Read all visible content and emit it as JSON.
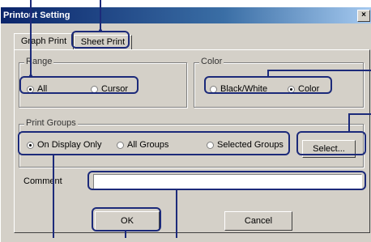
{
  "window": {
    "title": "Printout Setting",
    "close_glyph": "×"
  },
  "tabs": [
    {
      "label": "Graph Print"
    },
    {
      "label": "Sheet Print"
    }
  ],
  "range": {
    "legend": "Range",
    "options": [
      {
        "label": "All",
        "selected": true
      },
      {
        "label": "Cursor",
        "selected": false
      }
    ]
  },
  "color": {
    "legend": "Color",
    "options": [
      {
        "label": "Black/White",
        "selected": false
      },
      {
        "label": "Color",
        "selected": true
      }
    ]
  },
  "print_groups": {
    "legend": "Print Groups",
    "options": [
      {
        "label": "On Display Only",
        "selected": true
      },
      {
        "label": "All Groups",
        "selected": false
      },
      {
        "label": "Selected Groups",
        "selected": false
      }
    ],
    "select_label": "Select..."
  },
  "comment": {
    "label": "Comment",
    "value": ""
  },
  "buttons": {
    "ok": "OK",
    "cancel": "Cancel"
  },
  "accent_color": "#1c2a7a"
}
